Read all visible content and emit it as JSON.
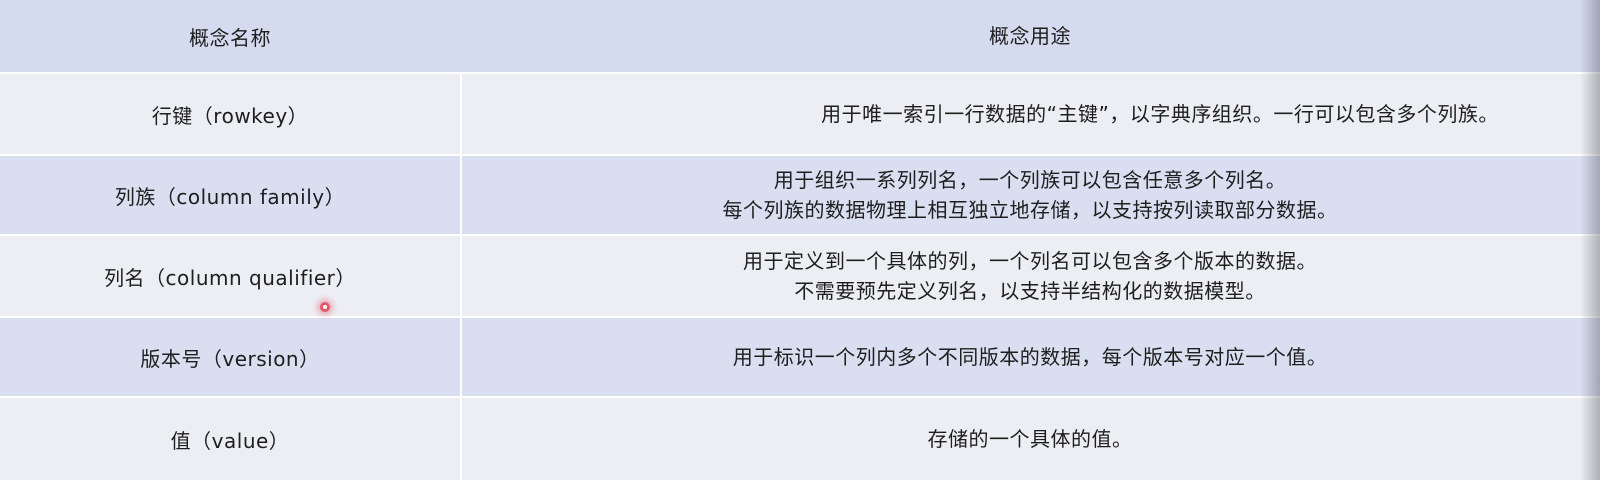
{
  "header": {
    "name": "概念名称",
    "use": "概念用途"
  },
  "rows": [
    {
      "name": "行键（rowkey）",
      "use": [
        "用于唯一索引一行数据的“主键”，以字典序组织。一行可以包含多个列族。"
      ]
    },
    {
      "name": "列族（column family）",
      "use": [
        "用于组织一系列列名，一个列族可以包含任意多个列名。",
        "每个列族的数据物理上相互独立地存储，以支持按列读取部分数据。"
      ]
    },
    {
      "name": "列名（column qualifier）",
      "use": [
        "用于定义到一个具体的列，一个列名可以包含多个版本的数据。",
        "不需要预先定义列名，以支持半结构化的数据模型。"
      ]
    },
    {
      "name": "版本号（version）",
      "use": [
        "用于标识一个列内多个不同版本的数据，每个版本号对应一个值。"
      ]
    },
    {
      "name": "值（value）",
      "use": [
        "存储的一个具体的值。"
      ]
    }
  ],
  "colors": {
    "header_bg": "#d5dbef",
    "row_light": "#eceef3",
    "row_dark": "#d9def1",
    "cursor_ring": "#e25a6a"
  }
}
